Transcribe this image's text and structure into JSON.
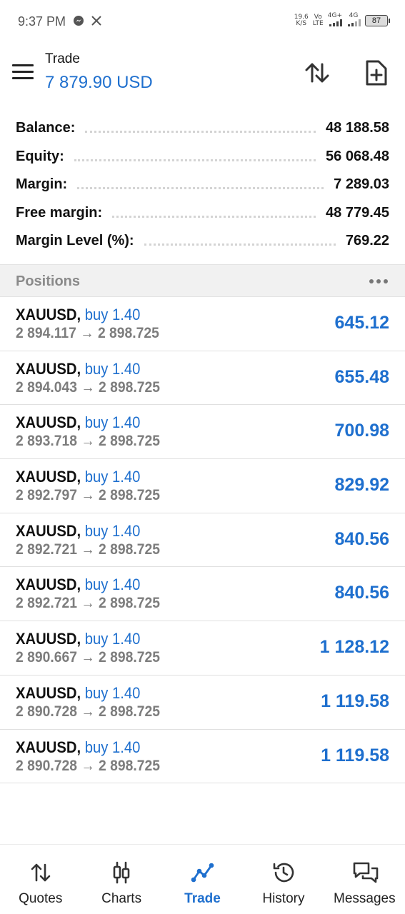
{
  "status_bar": {
    "time": "9:37 PM",
    "net_speed": "19.6",
    "net_unit": "K/S",
    "volte_top": "Vo",
    "volte_bottom": "LTE",
    "net1": "4G+",
    "net2": "4G",
    "battery": "87"
  },
  "header": {
    "title": "Trade",
    "balance_display": "7 879.90 USD"
  },
  "summary": [
    {
      "label": "Balance:",
      "value": "48 188.58"
    },
    {
      "label": "Equity:",
      "value": "56 068.48"
    },
    {
      "label": "Margin:",
      "value": "7 289.03"
    },
    {
      "label": "Free margin:",
      "value": "48 779.45"
    },
    {
      "label": "Margin Level (%):",
      "value": "769.22"
    }
  ],
  "positions_header": "Positions",
  "positions": [
    {
      "symbol": "XAUUSD,",
      "side": "buy 1.40",
      "prices": "2 894.117 → 2 898.725",
      "profit": "645.12"
    },
    {
      "symbol": "XAUUSD,",
      "side": "buy 1.40",
      "prices": "2 894.043 → 2 898.725",
      "profit": "655.48"
    },
    {
      "symbol": "XAUUSD,",
      "side": "buy 1.40",
      "prices": "2 893.718 → 2 898.725",
      "profit": "700.98"
    },
    {
      "symbol": "XAUUSD,",
      "side": "buy 1.40",
      "prices": "2 892.797 → 2 898.725",
      "profit": "829.92"
    },
    {
      "symbol": "XAUUSD,",
      "side": "buy 1.40",
      "prices": "2 892.721 → 2 898.725",
      "profit": "840.56"
    },
    {
      "symbol": "XAUUSD,",
      "side": "buy 1.40",
      "prices": "2 892.721 → 2 898.725",
      "profit": "840.56"
    },
    {
      "symbol": "XAUUSD,",
      "side": "buy 1.40",
      "prices": "2 890.667 → 2 898.725",
      "profit": "1 128.12"
    },
    {
      "symbol": "XAUUSD,",
      "side": "buy 1.40",
      "prices": "2 890.728 → 2 898.725",
      "profit": "1 119.58"
    },
    {
      "symbol": "XAUUSD,",
      "side": "buy 1.40",
      "prices": "2 890.728 → 2 898.725",
      "profit": "1 119.58"
    }
  ],
  "bottom_nav": [
    {
      "label": "Quotes",
      "icon": "quotes-icon",
      "active": false
    },
    {
      "label": "Charts",
      "icon": "charts-icon",
      "active": false
    },
    {
      "label": "Trade",
      "icon": "trade-icon",
      "active": true
    },
    {
      "label": "History",
      "icon": "history-icon",
      "active": false
    },
    {
      "label": "Messages",
      "icon": "messages-icon",
      "active": false
    }
  ],
  "colors": {
    "accent": "#1e6fce",
    "muted_text": "#7d7d7d",
    "section_bg": "#f1f1f1"
  }
}
